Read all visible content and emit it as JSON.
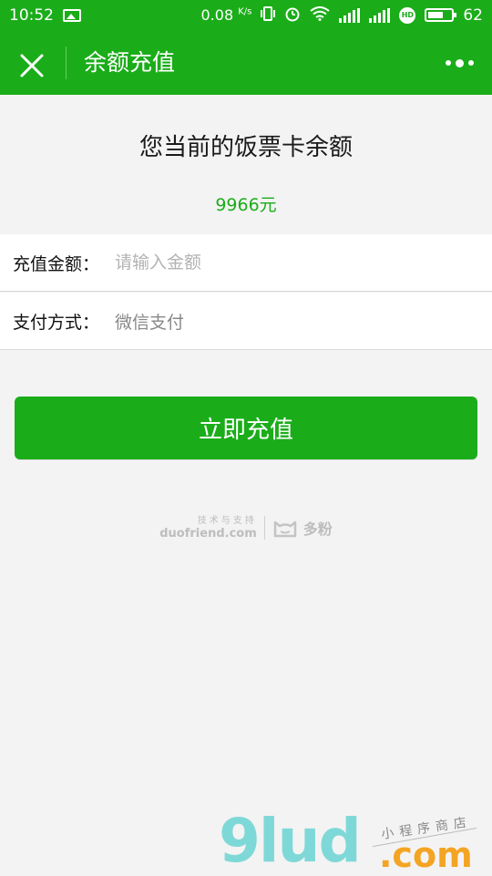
{
  "status_bar": {
    "time": "10:52",
    "net_speed": "0.08",
    "net_speed_unit": "K/s",
    "network": "4G",
    "battery": "62",
    "icons": [
      "image-icon",
      "vibrate-icon",
      "alarm-icon",
      "wifi-icon",
      "signal-icon",
      "hd-icon",
      "battery-icon"
    ]
  },
  "navbar": {
    "title": "余额充值"
  },
  "balance": {
    "heading": "您当前的饭票卡余额",
    "amount": "9966元"
  },
  "form": {
    "amount_label": "充值金额：",
    "amount_placeholder": "请输入金额",
    "payment_label": "支付方式：",
    "payment_value": "微信支付"
  },
  "submit_button": "立即充值",
  "support": {
    "small_text": "技术与支持",
    "domain": "duofriend.com",
    "brand": "多粉"
  },
  "watermark": {
    "logo": "9lud",
    "suffix": ".com",
    "tagline": "小程序商店"
  },
  "colors": {
    "brand_green": "#1aad19",
    "background": "#f3f3f3",
    "placeholder": "#b3b3b3"
  }
}
